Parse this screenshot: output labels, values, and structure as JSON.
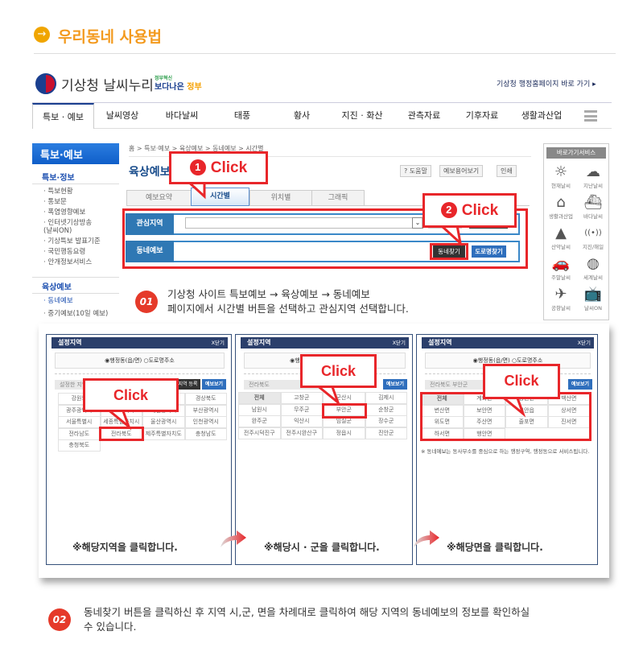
{
  "title": {
    "icon": "arrow-right-circle-icon",
    "text": "우리동네 사용법",
    "color": "#f39a1e"
  },
  "header": {
    "brand": "기상청 날씨누리",
    "gov_small": "정부혁신",
    "gov_big_a": "보다나은",
    "gov_big_b": "정부",
    "top_link": "기상청 행정홈페이지 바로 가기 ▸"
  },
  "nav": {
    "items": [
      "특보 · 예보",
      "날씨영상",
      "바다날씨",
      "태풍",
      "황사",
      "지진 · 화산",
      "관측자료",
      "기후자료",
      "생활과산업"
    ],
    "active": 0
  },
  "sidebar": {
    "head": "특보·예보",
    "sec1": "특보·정보",
    "items1": [
      "· 특보현황",
      "· 통보문",
      "· 폭염영향예보",
      "· 인터넷기상방송",
      "  (날씨ON)",
      "· 기상특보 발표기준",
      "· 국민행동요령",
      "· 안개정보서비스"
    ],
    "sec2": "육상예보",
    "items2": [
      "· 동네예보",
      "· 중기예보(10일 예보)"
    ]
  },
  "main": {
    "breadcrumb": "홈 > 특보·예보 > 육상예보 > 동네예보 > 시간별",
    "page_title": "육상예보",
    "tools": [
      "? 도움말",
      "예보용어보기",
      "인쇄"
    ],
    "tabs": [
      "예보요약",
      "시간별",
      "위치별",
      "그래픽"
    ],
    "selected_tab": 1,
    "row1_label": "관심지역",
    "row2_label": "동네예보",
    "btn_find": "동네찾기",
    "btn_road": "도로명찾기"
  },
  "callouts": {
    "c1_num": "1",
    "c1": "Click",
    "c2_num": "2",
    "c2": "Click",
    "p1": "Click",
    "p2": "Click",
    "p3": "Click"
  },
  "quick": {
    "head": "바로가기서비스",
    "items": [
      {
        "icon": "sun-icon",
        "glyph": "☼",
        "label": "현재날씨"
      },
      {
        "icon": "cloud-icon",
        "glyph": "☁",
        "label": "지난날씨"
      },
      {
        "icon": "house-icon",
        "glyph": "⌂",
        "label": "생활과산업"
      },
      {
        "icon": "ship-icon",
        "glyph": "⛴",
        "label": "바다날씨"
      },
      {
        "icon": "mountain-icon",
        "glyph": "▲",
        "label": "산악날씨"
      },
      {
        "icon": "antenna-icon",
        "glyph": "((•))",
        "label": "지진/해일"
      },
      {
        "icon": "car-icon",
        "glyph": "🚗",
        "label": "주말날씨"
      },
      {
        "icon": "globe-icon",
        "glyph": "◍",
        "label": "세계날씨"
      },
      {
        "icon": "airplane-icon",
        "glyph": "✈",
        "label": "공항날씨"
      },
      {
        "icon": "tv-icon",
        "glyph": "📺",
        "label": "날씨ON"
      }
    ]
  },
  "step1": {
    "num": "01",
    "line1": "기상청 사이트 특보예보 → 육상예보 → 동네예보",
    "line2": "페이지에서 시간별 버튼을 선택하고 관심지역 선택합니다."
  },
  "panels": [
    {
      "title": "설정지역",
      "close": "X닫기",
      "radio": "◉행정동(읍/면) ○도로명주소",
      "bar": "설정한 지역",
      "btn1": "관심지역 등록",
      "btn2": "예보보기",
      "cells": [
        [
          "강원도",
          "경기도",
          "경상남도",
          "경상북도"
        ],
        [
          "광주광역시",
          "대구광역시",
          "대전광역시",
          "부산광역시"
        ],
        [
          "서울특별시",
          "세종특별자치시",
          "울산광역시",
          "인천광역시"
        ],
        [
          "전라남도",
          "전라북도",
          "제주특별자치도",
          "충청남도"
        ],
        [
          "충청북도"
        ]
      ],
      "caption": "※해당지역을 클릭합니다."
    },
    {
      "title": "설정지역",
      "close": "X닫기",
      "radio": "◉행정동(읍/면) ○도로명주소",
      "bar": "전라북도",
      "btn2": "예보보기",
      "cells": [
        [
          "전체",
          "고창군",
          "군산시",
          "김제시"
        ],
        [
          "남원시",
          "무주군",
          "부안군",
          "순창군"
        ],
        [
          "완주군",
          "익산시",
          "임실군",
          "장수군"
        ],
        [
          "전주시덕진구",
          "전주시완산구",
          "정읍시",
          "진안군"
        ]
      ],
      "caption": "※해당시 · 군을 클릭합니다."
    },
    {
      "title": "설정지역",
      "close": "X닫기",
      "radio": "◉행정동(읍/면) ○도로명주소",
      "bar": "전라북도 부안군",
      "btn2": "예보보기",
      "cells": [
        [
          "전체",
          "계화면",
          "동진면",
          "백산면"
        ],
        [
          "변산면",
          "보안면",
          "부안읍",
          "상서면"
        ],
        [
          "위도면",
          "주산면",
          "줄포면",
          "진서면"
        ],
        [
          "하서면",
          "행안면"
        ]
      ],
      "note": "※ 동네예보는 동사무소를 중심으로 하는 행정구역, 행정동으로 서비스됩니다.",
      "caption": "※해당면을 클릭합니다."
    }
  ],
  "step2": {
    "num": "02",
    "line1": "동네찾기 버튼을 클릭하신  후 지역 시,군, 면을 차례대로 클릭하여 해당 지역의 동네예보의 정보를 확인하실",
    "line2": "수 있습니다."
  },
  "colors": {
    "accent_red": "#e8262a",
    "nav_blue": "#1a3f8f",
    "label_blue": "#2f78b4"
  }
}
